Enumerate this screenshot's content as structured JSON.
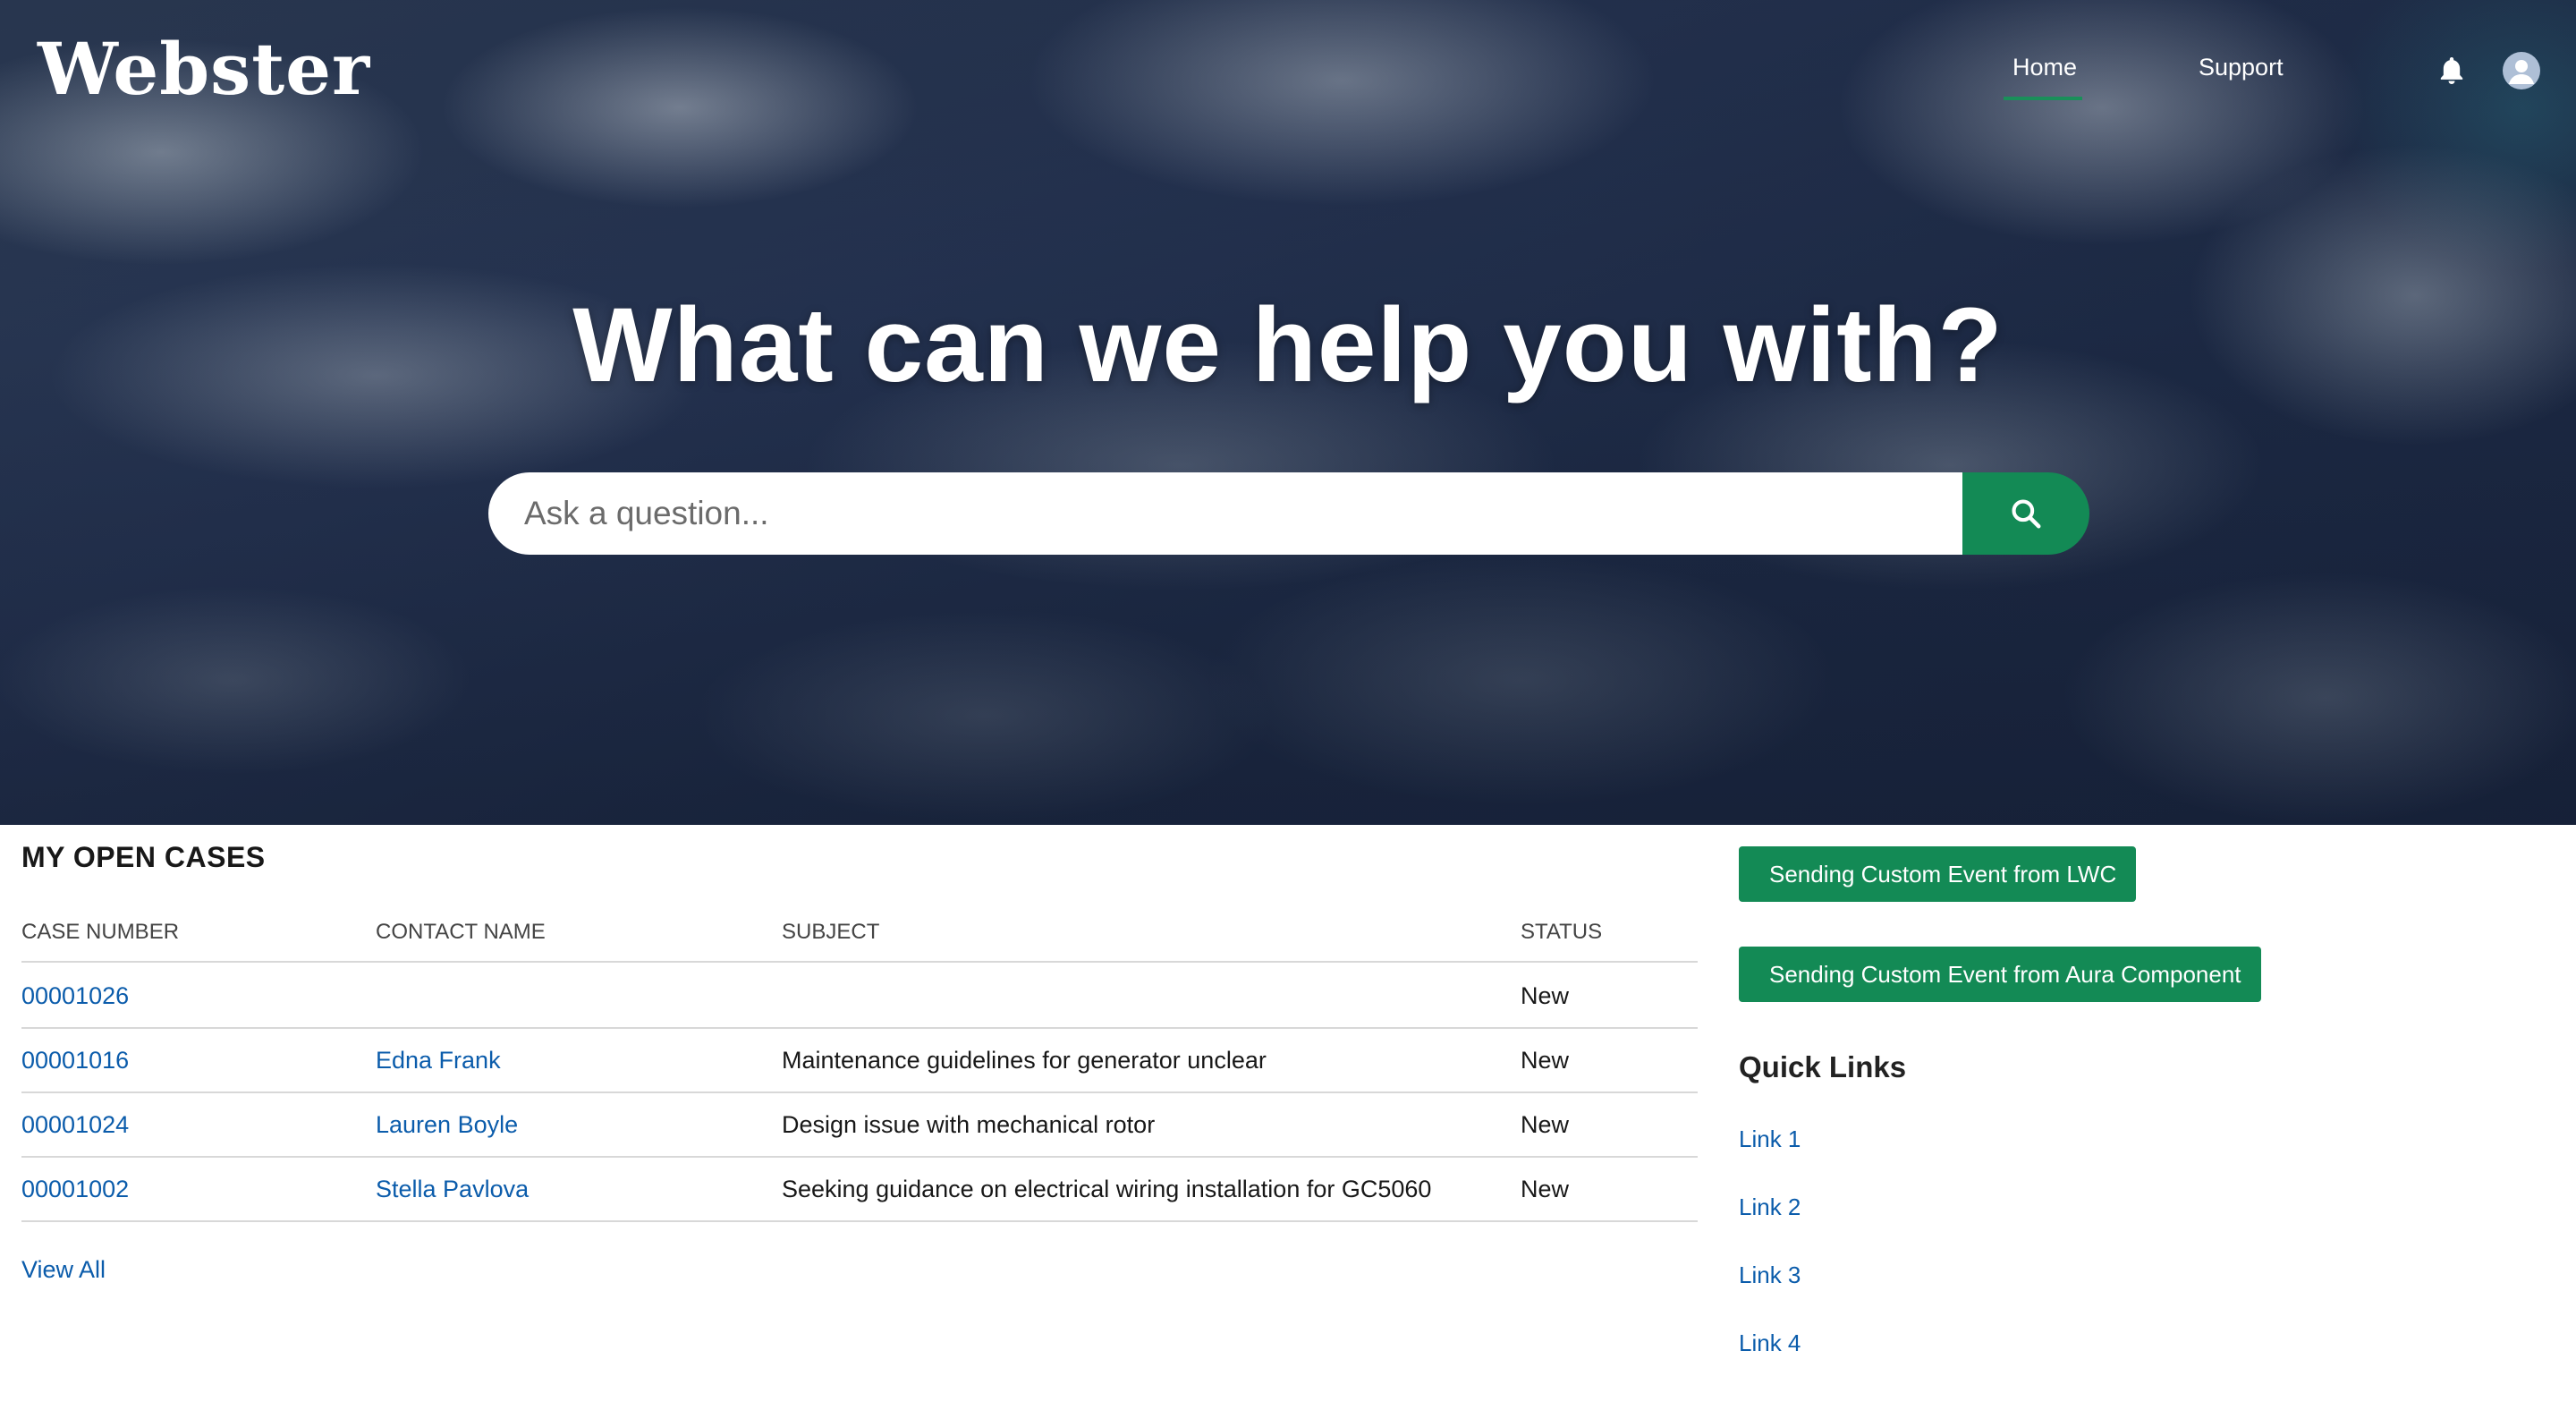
{
  "header": {
    "logo": "Webster",
    "nav": [
      {
        "label": "Home",
        "active": true
      },
      {
        "label": "Support",
        "active": false
      }
    ],
    "icons": [
      "bell-icon",
      "user-avatar-icon"
    ]
  },
  "hero": {
    "headline": "What can we help you with?",
    "search": {
      "placeholder": "Ask a question...",
      "value": ""
    },
    "search_icon": "search-icon"
  },
  "cases": {
    "title": "MY OPEN CASES",
    "columns": [
      "CASE NUMBER",
      "CONTACT NAME",
      "SUBJECT",
      "STATUS"
    ],
    "rows": [
      {
        "case_number": "00001026",
        "contact": "",
        "subject": "",
        "status": "New"
      },
      {
        "case_number": "00001016",
        "contact": "Edna Frank",
        "subject": "Maintenance guidelines for generator unclear",
        "status": "New"
      },
      {
        "case_number": "00001024",
        "contact": "Lauren Boyle",
        "subject": "Design issue with mechanical rotor",
        "status": "New"
      },
      {
        "case_number": "00001002",
        "contact": "Stella Pavlova",
        "subject": "Seeking guidance on electrical wiring installation for GC5060",
        "status": "New"
      }
    ],
    "view_all": "View All"
  },
  "side": {
    "button_lwc": "Sending Custom Event from LWC",
    "button_aura": "Sending Custom Event from Aura Component",
    "quick_links_title": "Quick Links",
    "links": [
      "Link 1",
      "Link 2",
      "Link 3",
      "Link 4"
    ]
  },
  "colors": {
    "accent_green": "#138a55",
    "link_blue": "#0b5cab",
    "hero_dark": "#1c2944"
  }
}
